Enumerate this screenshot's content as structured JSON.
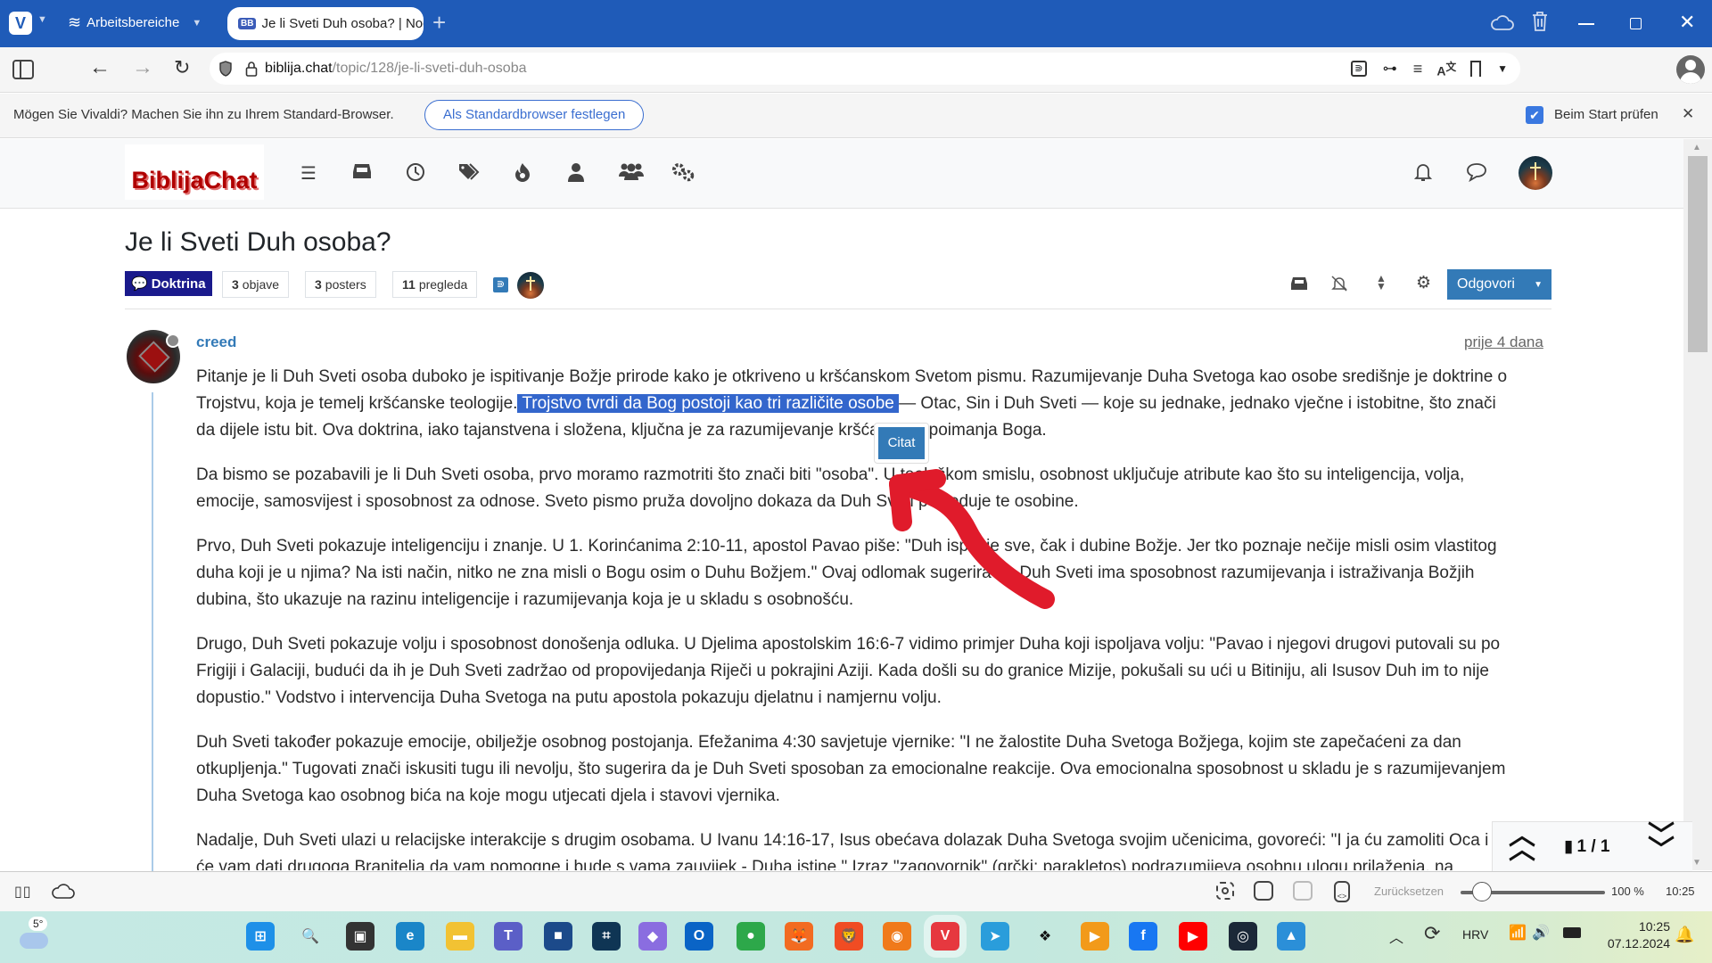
{
  "browser": {
    "workspaces_label": "Arbeitsbereiche",
    "tab_title": "Je li Sveti Duh osoba? | Noc",
    "url_domain": "biblija.chat",
    "url_path": "/topic/128/je-li-sveti-duh-osoba",
    "titlebar_color": "#1f5bb8"
  },
  "notification": {
    "message": "Mögen Sie Vivaldi? Machen Sie ihn zu Ihrem Standard-Browser.",
    "set_default_button": "Als Standardbrowser festlegen",
    "check_on_start_label": "Beim Start prüfen",
    "check_on_start_checked": true,
    "close": "✕"
  },
  "site": {
    "logo_text": "BiblijaChat",
    "logo_color": "#b00000",
    "nav_icons": [
      "list-icon",
      "inbox-icon",
      "clock-icon",
      "tags-icon",
      "fire-icon",
      "user-icon",
      "users-icon",
      "cogs-icon"
    ]
  },
  "topic": {
    "title": "Je li Sveti Duh osoba?",
    "category": "Doktrina",
    "category_color": "#1a1a8c",
    "posts_count": "3",
    "posts_label": "objave",
    "posters_count": "3",
    "posters_label": "posters",
    "views_count": "11",
    "views_label": "pregleda",
    "reply_button": "Odgovori",
    "reply_color": "#337ab7"
  },
  "post": {
    "author": "creed",
    "timestamp": "prije 4 dana",
    "quote_button": "Citat",
    "p1_before": "Pitanje je li Duh Sveti osoba duboko je ispitivanje Božje prirode kako je otkriveno u kršćanskom Svetom pismu. Razumijevanje Duha Svetoga kao osobe središnje je doktrine o",
    "p1_line2_before": "Trojstvu, koja je temelj kršćanske teologije.",
    "p1_selected": " Trojstvo tvrdi da Bog postoji kao tri različite osobe ",
    "p1_line2_after": "— Otac, Sin i Duh Sveti — koje su jednake, jednako vječne i istobitne, što znači",
    "p1_line3": "da dijele istu bit. Ova doktrina, iako tajanstvena i složena, ključna je za razumijevanje kršćanskog poimanja Boga.",
    "p2_line1": "Da bismo se pozabavili je li Duh Sveti osoba, prvo moramo razmotriti što znači biti \"osoba\". U teološkom smislu, osobnost uključuje atribute kao što su inteligencija, volja,",
    "p2_line2": "emocije, samosvijest i sposobnost za odnose. Sveto pismo pruža dovoljno dokaza da Duh Sveti posjeduje te osobine.",
    "p3_line1": "Prvo, Duh Sveti pokazuje inteligenciju i znanje. U 1. Korinćanima 2:10-11, apostol Pavao piše: \"Duh ispituje sve, čak i dubine Božje. Jer tko poznaje nečije misli osim vlastitog",
    "p3_line2": "duha koji je u njima? Na isti način, nitko ne zna misli o Bogu osim o Duhu Božjem.\" Ovaj odlomak sugerira da Duh Sveti ima sposobnost razumijevanja i istraživanja Božjih",
    "p3_line3": "dubina, što ukazuje na razinu inteligencije i razumijevanja koja je u skladu s osobnošću.",
    "p4_line1": "Drugo, Duh Sveti pokazuje volju i sposobnost donošenja odluka. U Djelima apostolskim 16:6-7 vidimo primjer Duha koji ispoljava volju: \"Pavao i njegovi drugovi putovali su po",
    "p4_line2": "Frigiji i Galaciji, budući da ih je Duh Sveti zadržao od propovijedanja Riječi u pokrajini Aziji. Kada došli su do granice Mizije, pokušali su ući u Bitiniju, ali Isusov Duh im to nije",
    "p4_line3": "dopustio.\" Vodstvo i intervencija Duha Svetoga na putu apostola pokazuju djelatnu i namjernu volju.",
    "p5_line1": "Duh Sveti također pokazuje emocije, obilježje osobnog postojanja. Efežanima 4:30 savjetuje vjernike: \"I ne žalostite Duha Svetoga Božjega, kojim ste zapečaćeni za dan",
    "p5_line2": "otkupljenja.\" Tugovati znači iskusiti tugu ili nevolju, što sugerira da je Duh Sveti sposoban za emocionalne reakcije. Ova emocionalna sposobnost u skladu je s razumijevanjem",
    "p5_line3": "Duha Svetoga kao osobnog bića na koje mogu utjecati djela i stavovi vjernika.",
    "p6_line1": "Nadalje, Duh Sveti ulazi u relacijske interakcije s drugim osobama. U Ivanu 14:16-17, Isus obećava dolazak Duha Svetoga svojim učenicima, govoreći: \"I ja ću zamoliti Oca i on",
    "p6_line2": "će vam dati drugoga Branitelja da vam pomogne i bude s vama zauvijek - Duha istine.\" Izraz \"zagovornik\" (grčki: parakletos) podrazumijeva osobnu ulogu prilaženja, na"
  },
  "pagination": {
    "current": "1 / 1"
  },
  "statusbar": {
    "reset_label": "Zurücksetzen",
    "zoom_level": "100 %",
    "zoom_fraction": 0.15,
    "clock": "10:25"
  },
  "taskbar": {
    "weather": "5°",
    "language": "HRV",
    "time": "10:25",
    "date": "07.12.2024",
    "apps": [
      "start",
      "search",
      "task-view",
      "edge",
      "file-explorer",
      "teams",
      "store",
      "app-9",
      "copilot",
      "outlook",
      "chrome",
      "firefox",
      "brave",
      "avast",
      "vivaldi",
      "telegram",
      "dropbox",
      "media-player",
      "facebook",
      "youtube",
      "steam",
      "photos"
    ]
  }
}
